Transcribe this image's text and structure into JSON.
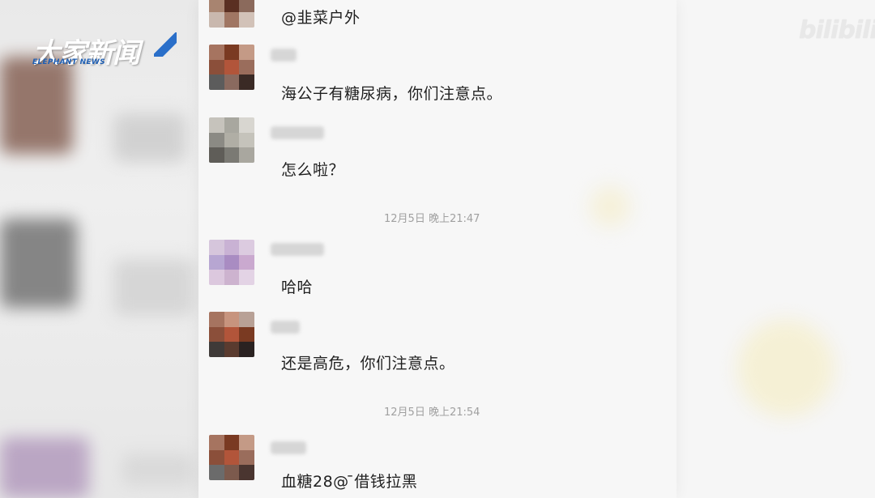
{
  "watermarks": {
    "news_logo_main": "大家新闻",
    "news_logo_sub": "ELEPHANT NEWS",
    "bilibili": "bilibili"
  },
  "chat": {
    "messages": [
      {
        "text": "@韭菜户外"
      },
      {
        "text": "海公子有糖尿病，你们注意点。"
      },
      {
        "text": "怎么啦？"
      },
      {
        "text": "哈哈"
      },
      {
        "text": "还是高危，你们注意点。"
      },
      {
        "text": "血糖28@ ̄借钱拉黑"
      }
    ],
    "timestamps": [
      {
        "text": "12月5日 晚上21:47"
      },
      {
        "text": "12月5日 晚上21:54"
      }
    ]
  },
  "colors": {
    "chat_bg": "#f7f7f7",
    "text": "#1f1f1f",
    "timestamp": "#a0a0a0",
    "logo_blue": "#2a6fc9"
  }
}
